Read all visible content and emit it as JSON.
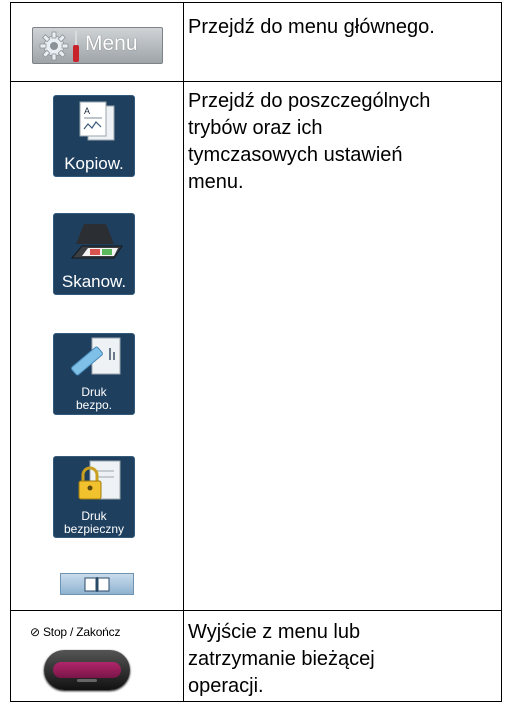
{
  "rows": [
    {
      "button": {
        "label": "Menu",
        "icon": "gear-icon"
      },
      "description": "Przejdź do menu głównego."
    },
    {
      "buttons": [
        {
          "label": "Kopiow.",
          "icon": "copy-icon"
        },
        {
          "label": "Skanow.",
          "icon": "scanner-icon"
        },
        {
          "label_lines": [
            "Druk",
            "bezpo."
          ],
          "icon": "usb-direct-print-icon"
        },
        {
          "label_lines": [
            "Druk",
            "bezpieczny"
          ],
          "icon": "lock-icon"
        },
        {
          "label": "",
          "icon": "book-icon"
        }
      ],
      "description_lines": [
        "Przejdź do poszczególnych",
        "trybów oraz ich",
        "tymczasowych ustawień",
        "menu."
      ]
    },
    {
      "key_label": "Stop / Zakończ",
      "description_lines": [
        "Wyjście z menu lub",
        "zatrzymanie bieżącej",
        "operacji."
      ]
    }
  ],
  "colors": {
    "tile": "#1e3f5e",
    "stop_bar": "#9b1f5d",
    "menu_button": "#b4b9bd"
  }
}
